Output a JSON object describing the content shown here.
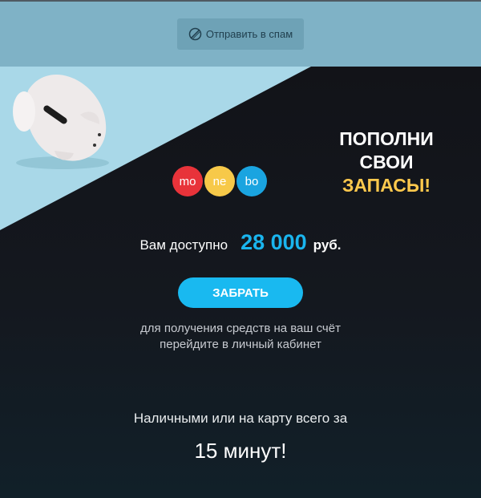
{
  "spam_bar": {
    "button_label": "Отправить в спам",
    "icon": "block-icon"
  },
  "hero": {
    "image": "piggy-bank-photo",
    "headline": {
      "line1": "ПОПОЛНИ",
      "line2": "СВОИ",
      "line3": "ЗАПАСЫ!"
    },
    "logo": [
      {
        "text": "mo",
        "color": "#e8333a"
      },
      {
        "text": "ne",
        "color": "#f7c949"
      },
      {
        "text": "bo",
        "color": "#1aa4e0"
      }
    ],
    "available": {
      "label": "Вам доступно",
      "amount": "28 000",
      "currency": "руб."
    },
    "cta": {
      "label": "ЗАБРАТЬ"
    },
    "cta_note": {
      "line1": "для получения средств на ваш счёт",
      "line2": "перейдите в личный кабинет"
    },
    "cash_text": "Наличными или на карту всего за",
    "minutes_text": "15 минут!"
  },
  "colors": {
    "accent": "#19b9f0",
    "headline_highlight": "#ffc94d",
    "background": "#121419",
    "spam_bar": "#7fb2c6"
  }
}
